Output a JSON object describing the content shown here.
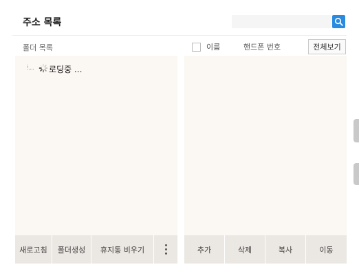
{
  "header": {
    "title": "주소 목록",
    "search": {
      "value": "",
      "placeholder": ""
    }
  },
  "left": {
    "label": "폴더 목록",
    "loading_text": "로딩중 ...",
    "buttons": [
      "새로고침",
      "폴더생성",
      "휴지통 비우기"
    ],
    "more_icon": "vertical-ellipsis-icon"
  },
  "right": {
    "col_name": "이름",
    "col_phone": "핸드폰 번호",
    "view_all": "전체보기",
    "buttons": [
      "추가",
      "삭제",
      "복사",
      "이동"
    ]
  },
  "colors": {
    "accent": "#2a8ae0",
    "panel_bg": "#fbf7f2",
    "button_bg": "#ebe7e2"
  }
}
